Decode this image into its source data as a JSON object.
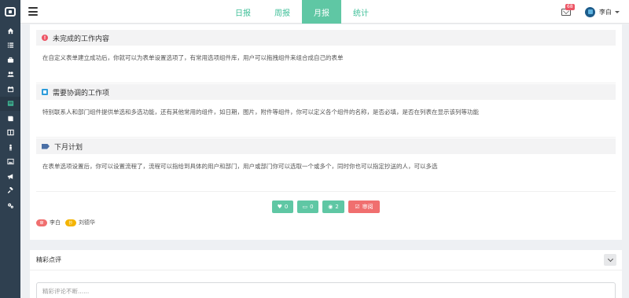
{
  "sidebar": {
    "icons": [
      "home-icon",
      "list-icon",
      "briefcase-icon",
      "users-icon",
      "calendar-icon",
      "report-icon",
      "book-icon",
      "columns-icon",
      "person-icon",
      "image-icon",
      "bullhorn-icon",
      "gavel-icon",
      "cogs-icon"
    ],
    "active_index": 5
  },
  "tabs": [
    "日报",
    "周报",
    "月报",
    "统计"
  ],
  "active_tab": 2,
  "header": {
    "mail_count": "68",
    "username": "李白"
  },
  "sections": [
    {
      "title": "未完成的工作内容",
      "icon": "alert-circle-icon",
      "body": "在自定义表单建立成功后，你就可以为表单设置选项了，有常用选项组件库，用户可以拖拽组件来组合成自己的表单"
    },
    {
      "title": "需要协调的工作项",
      "icon": "square-icon",
      "body": "特别联系人和部门组件提供单选和多选功能，还有其他常用的组件，如日期，图片，附件等组件，你可以定义各个组件的名称，是否必填，是否在列表在显示该列等功能"
    },
    {
      "title": "下月计划",
      "icon": "tags-icon",
      "body": "在表单选项设置后，你可以设置流程了，流程可以指给到具体的用户和部门，用户或部门你可以选取一个或多个，同时你也可以指定抄送的人，可以多选"
    }
  ],
  "actions": {
    "like": "0",
    "comment": "0",
    "view": "2",
    "review": "审阅"
  },
  "people": [
    {
      "badge": "审",
      "name": "李白"
    },
    {
      "badge": "抄",
      "name": "刘德华"
    }
  ],
  "comments": {
    "title": "精彩点评",
    "placeholder": "精彩评论不断......"
  },
  "colors": {
    "accent": "#5fc7a4",
    "sidebar": "#2f4050",
    "danger": "#f06f6f",
    "warning": "#f4b400"
  }
}
